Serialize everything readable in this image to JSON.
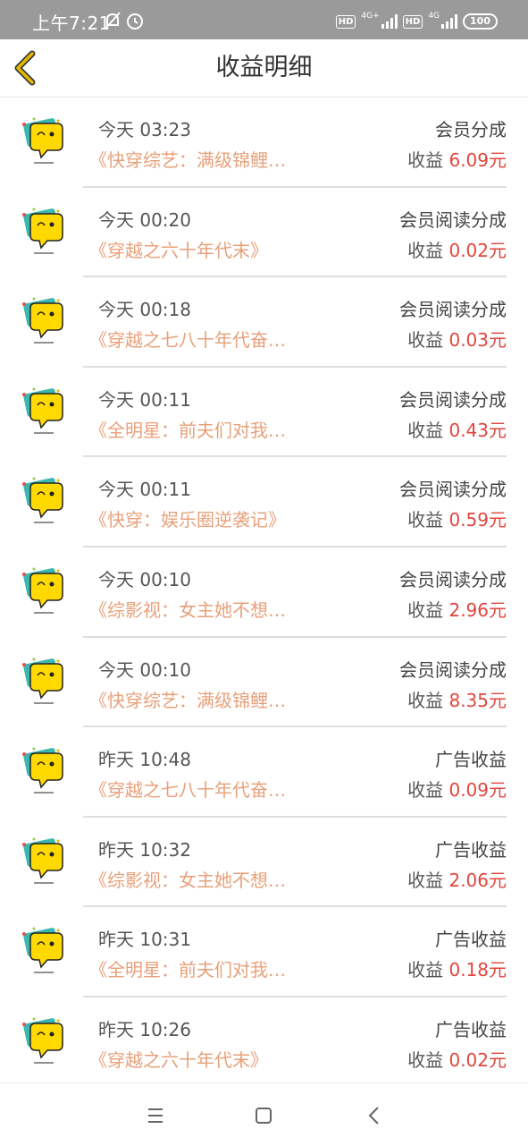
{
  "status_bar": {
    "time": "上午7:21",
    "hd1": "HD",
    "net1": "4G+",
    "hd2": "HD",
    "net2": "4G",
    "battery": "100"
  },
  "header": {
    "title": "收益明细"
  },
  "earning_prefix": "收益",
  "currency_suffix": "元",
  "colors": {
    "accent_gold": "#e6b800",
    "amount_red": "#e0463e",
    "book_orange": "#e8a07a"
  },
  "entries": [
    {
      "time": "今天 03:23",
      "type": "会员分成",
      "book": "《快穿综艺：满级锦鲤…",
      "amount": "6.09"
    },
    {
      "time": "今天 00:20",
      "type": "会员阅读分成",
      "book": "《穿越之六十年代末》",
      "amount": "0.02"
    },
    {
      "time": "今天 00:18",
      "type": "会员阅读分成",
      "book": "《穿越之七八十年代奋…",
      "amount": "0.03"
    },
    {
      "time": "今天 00:11",
      "type": "会员阅读分成",
      "book": "《全明星：前夫们对我…",
      "amount": "0.43"
    },
    {
      "time": "今天 00:11",
      "type": "会员阅读分成",
      "book": "《快穿：娱乐圈逆袭记》",
      "amount": "0.59"
    },
    {
      "time": "今天 00:10",
      "type": "会员阅读分成",
      "book": "《综影视：女主她不想…",
      "amount": "2.96"
    },
    {
      "time": "今天 00:10",
      "type": "会员阅读分成",
      "book": "《快穿综艺：满级锦鲤…",
      "amount": "8.35"
    },
    {
      "time": "昨天 10:48",
      "type": "广告收益",
      "book": "《穿越之七八十年代奋…",
      "amount": "0.09"
    },
    {
      "time": "昨天 10:32",
      "type": "广告收益",
      "book": "《综影视：女主她不想…",
      "amount": "2.06"
    },
    {
      "time": "昨天 10:31",
      "type": "广告收益",
      "book": "《全明星：前夫们对我…",
      "amount": "0.18"
    },
    {
      "time": "昨天 10:26",
      "type": "广告收益",
      "book": "《穿越之六十年代末》",
      "amount": "0.02"
    }
  ]
}
